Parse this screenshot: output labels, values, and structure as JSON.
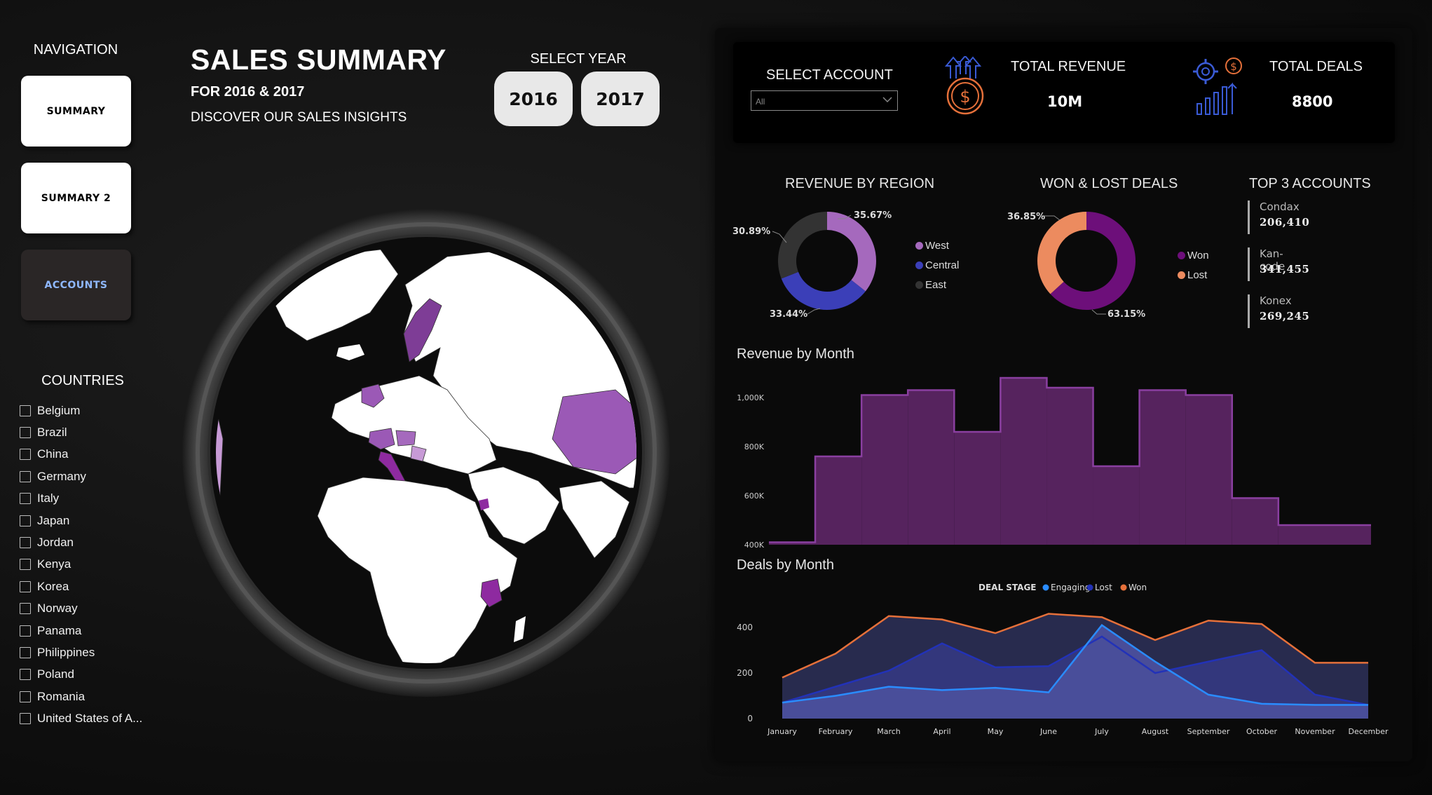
{
  "nav": {
    "title": "NAVIGATION",
    "buttons": [
      "SUMMARY",
      "SUMMARY 2",
      "ACCOUNTS"
    ]
  },
  "countries": {
    "title": "COUNTRIES",
    "items": [
      "Belgium",
      "Brazil",
      "China",
      "Germany",
      "Italy",
      "Japan",
      "Jordan",
      "Kenya",
      "Korea",
      "Norway",
      "Panama",
      "Philippines",
      "Poland",
      "Romania",
      "United States of A..."
    ]
  },
  "header": {
    "title": "SALES SUMMARY",
    "subtitle": "FOR 2016 & 2017",
    "description": "DISCOVER OUR SALES INSIGHTS",
    "select_year": "SELECT YEAR",
    "years": [
      "2016",
      "2017"
    ]
  },
  "kpis": {
    "select_account": "SELECT ACCOUNT",
    "select_value": "All",
    "revenue_label": "TOTAL REVENUE",
    "revenue_value": "10M",
    "deals_label": "TOTAL DEALS",
    "deals_value": "8800"
  },
  "colors": {
    "west": "#a569bd",
    "central": "#3b3fb8",
    "east": "#333333",
    "won": "#6d0f7a",
    "lost": "#ec8b5f",
    "engaging": "#2a8cff",
    "lost_line": "#2232b8",
    "won_line": "#e5703a",
    "revenue_fill": "#56235e",
    "revenue_line": "#8a3fa0",
    "map_highlight": "#9b59b6"
  },
  "revenue_by_region": {
    "title": "REVENUE BY REGION",
    "slices": [
      {
        "name": "West",
        "pct_label": "35.67%",
        "value": 35.67
      },
      {
        "name": "Central",
        "pct_label": "33.44%",
        "value": 33.44
      },
      {
        "name": "East",
        "pct_label": "30.89%",
        "value": 30.89
      }
    ]
  },
  "won_lost": {
    "title": "WON & LOST DEALS",
    "slices": [
      {
        "name": "Won",
        "pct_label": "63.15%",
        "value": 63.15
      },
      {
        "name": "Lost",
        "pct_label": "36.85%",
        "value": 36.85
      }
    ]
  },
  "top_accounts": {
    "title": "TOP 3 ACCOUNTS",
    "items": [
      {
        "name": "Condax",
        "value": "206,410"
      },
      {
        "name": "Kan-code",
        "value": "341,455"
      },
      {
        "name": "Konex",
        "value": "269,245"
      }
    ]
  },
  "chart_data": [
    {
      "type": "area",
      "title": "Revenue by Month",
      "categories": [
        "January",
        "February",
        "March",
        "April",
        "May",
        "June",
        "July",
        "August",
        "September",
        "October",
        "November",
        "December"
      ],
      "values": [
        410000,
        760000,
        1010000,
        1030000,
        860000,
        1080000,
        1040000,
        720000,
        1030000,
        1010000,
        590000,
        480000
      ],
      "ylim": [
        400000,
        1000000
      ],
      "yticks": [
        "400K",
        "600K",
        "800K",
        "1,000K"
      ],
      "step": true
    },
    {
      "type": "area",
      "title": "Deals by Month",
      "legend_title": "DEAL STAGE",
      "categories": [
        "January",
        "February",
        "March",
        "April",
        "May",
        "June",
        "July",
        "August",
        "September",
        "October",
        "November",
        "December"
      ],
      "ylim": [
        0,
        400
      ],
      "yticks": [
        "0",
        "200",
        "400"
      ],
      "series": [
        {
          "name": "Engaging",
          "values": [
            70,
            100,
            140,
            125,
            135,
            115,
            410,
            250,
            105,
            65,
            60,
            60
          ]
        },
        {
          "name": "Lost",
          "values": [
            70,
            140,
            210,
            330,
            225,
            230,
            360,
            200,
            250,
            300,
            105,
            60
          ]
        },
        {
          "name": "Won",
          "values": [
            180,
            285,
            450,
            435,
            375,
            460,
            445,
            345,
            430,
            415,
            245,
            245
          ]
        }
      ]
    }
  ]
}
